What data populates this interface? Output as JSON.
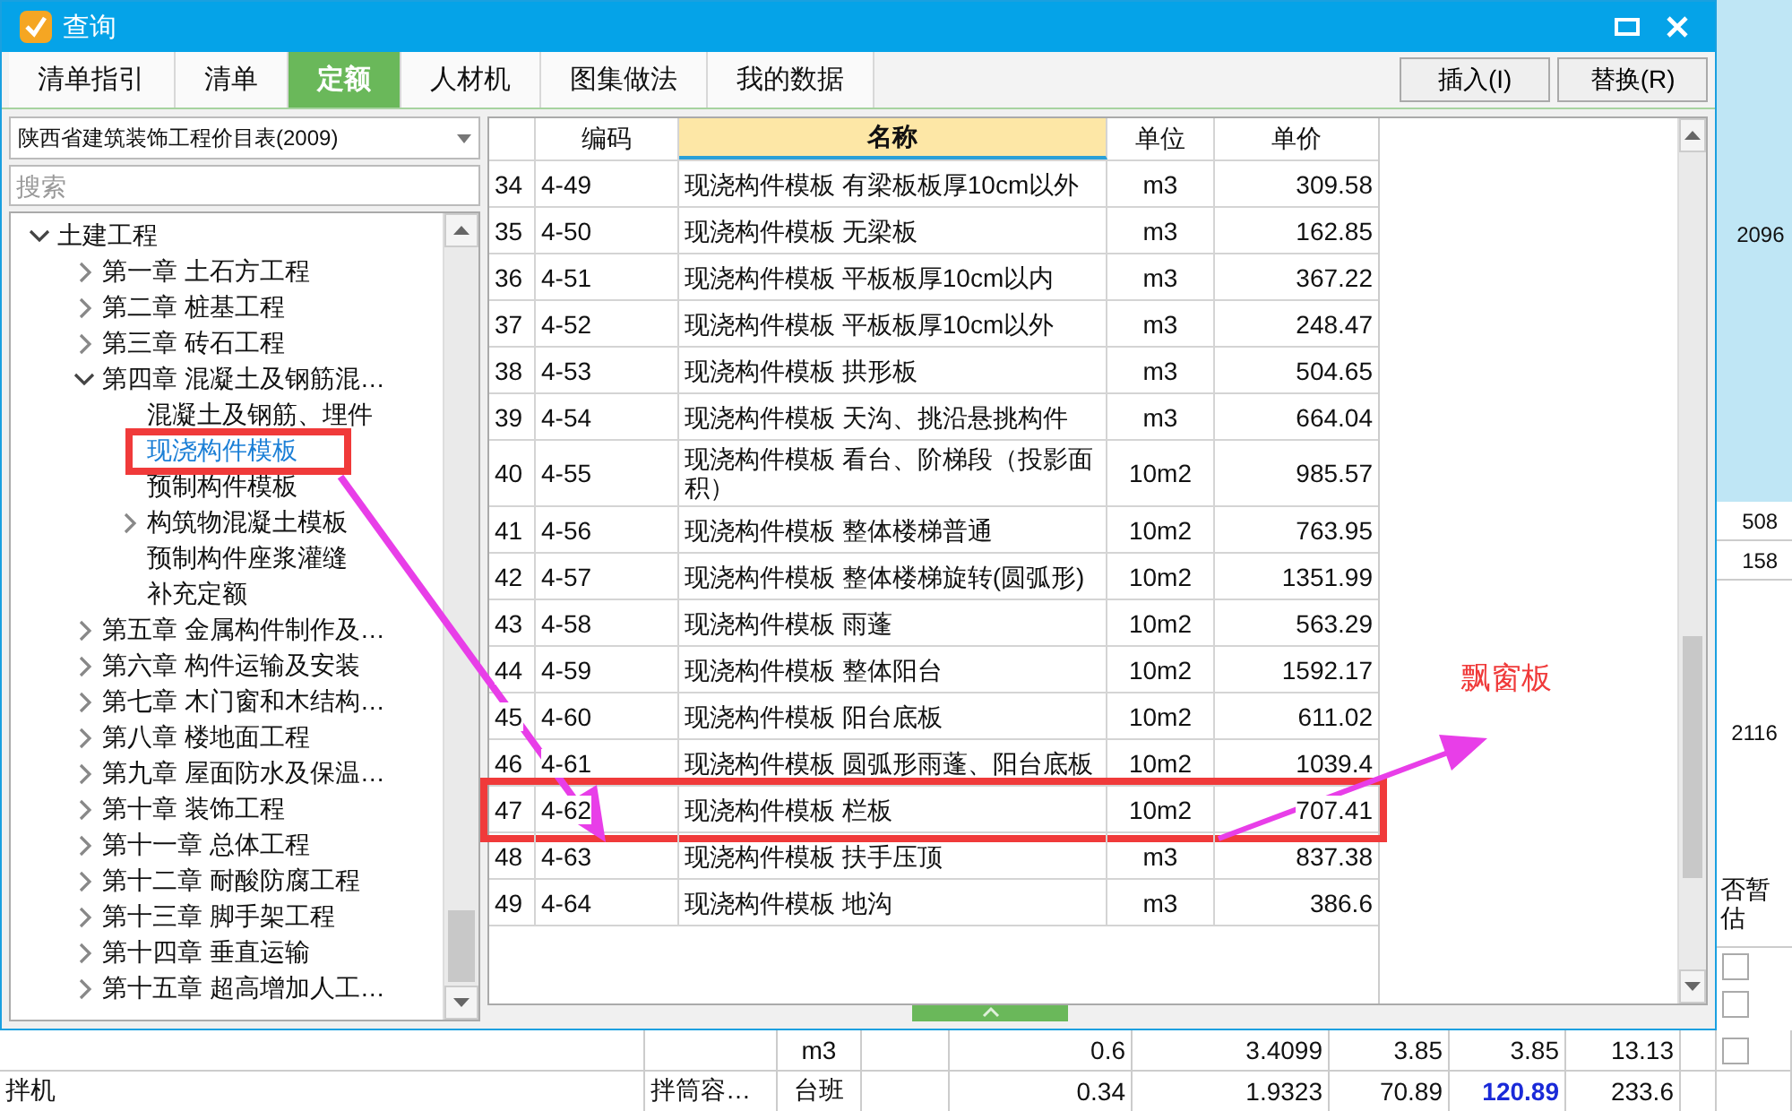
{
  "window": {
    "title": "查询"
  },
  "tabs": [
    {
      "label": "清单指引",
      "selected": false
    },
    {
      "label": "清单",
      "selected": false
    },
    {
      "label": "定额",
      "selected": true
    },
    {
      "label": "人材机",
      "selected": false
    },
    {
      "label": "图集做法",
      "selected": false
    },
    {
      "label": "我的数据",
      "selected": false
    }
  ],
  "buttons": [
    "插入(I)",
    "替换(R)"
  ],
  "library": {
    "value": "陕西省建筑装饰工程价目表(2009)"
  },
  "search": {
    "placeholder": "搜索"
  },
  "tree": {
    "items": [
      {
        "label": "土建工程",
        "expanded": true,
        "selected": false,
        "children": [
          {
            "label": "第一章  土石方工程",
            "expanded": false,
            "selected": false
          },
          {
            "label": "第二章  桩基工程",
            "expanded": false,
            "selected": false
          },
          {
            "label": "第三章  砖石工程",
            "expanded": false,
            "selected": false
          },
          {
            "label": "第四章  混凝土及钢筋混…",
            "expanded": true,
            "selected": false,
            "children": [
              {
                "label": "混凝土及钢筋、埋件",
                "selected": false
              },
              {
                "label": "现浇构件模板",
                "selected": true,
                "marked": true
              },
              {
                "label": "预制构件模板",
                "selected": false
              },
              {
                "label": "构筑物混凝土模板",
                "expanded": false,
                "selected": false
              },
              {
                "label": "预制构件座浆灌缝",
                "selected": false
              },
              {
                "label": "补充定额",
                "selected": false
              }
            ]
          },
          {
            "label": "第五章  金属构件制作及…",
            "expanded": false,
            "selected": false
          },
          {
            "label": "第六章  构件运输及安装",
            "expanded": false,
            "selected": false
          },
          {
            "label": "第七章  木门窗和木结构…",
            "expanded": false,
            "selected": false
          },
          {
            "label": "第八章  楼地面工程",
            "expanded": false,
            "selected": false
          },
          {
            "label": "第九章  屋面防水及保温…",
            "expanded": false,
            "selected": false
          },
          {
            "label": "第十章  装饰工程",
            "expanded": false,
            "selected": false
          },
          {
            "label": "第十一章  总体工程",
            "expanded": false,
            "selected": false
          },
          {
            "label": "第十二章  耐酸防腐工程",
            "expanded": false,
            "selected": false
          },
          {
            "label": "第十三章  脚手架工程",
            "expanded": false,
            "selected": false
          },
          {
            "label": "第十四章  垂直运输",
            "expanded": false,
            "selected": false
          },
          {
            "label": "第十五章  超高增加人工…",
            "expanded": false,
            "selected": false
          }
        ]
      }
    ]
  },
  "table": {
    "columns": [
      {
        "label": "编码",
        "selected": false
      },
      {
        "label": "名称",
        "selected": true
      },
      {
        "label": "单位",
        "selected": false
      },
      {
        "label": "单价",
        "selected": false
      }
    ],
    "rows": [
      {
        "no": "34",
        "code": "4-49",
        "name": "现浇构件模板 有梁板板厚10cm以外",
        "unit": "m3",
        "price": "309.58",
        "marked": false
      },
      {
        "no": "35",
        "code": "4-50",
        "name": "现浇构件模板 无梁板",
        "unit": "m3",
        "price": "162.85",
        "marked": false
      },
      {
        "no": "36",
        "code": "4-51",
        "name": "现浇构件模板 平板板厚10cm以内",
        "unit": "m3",
        "price": "367.22",
        "marked": false
      },
      {
        "no": "37",
        "code": "4-52",
        "name": "现浇构件模板 平板板厚10cm以外",
        "unit": "m3",
        "price": "248.47",
        "marked": false
      },
      {
        "no": "38",
        "code": "4-53",
        "name": "现浇构件模板 拱形板",
        "unit": "m3",
        "price": "504.65",
        "marked": false
      },
      {
        "no": "39",
        "code": "4-54",
        "name": "现浇构件模板 天沟、挑沿悬挑构件",
        "unit": "m3",
        "price": "664.04",
        "marked": false
      },
      {
        "no": "40",
        "code": "4-55",
        "name": "现浇构件模板 看台、阶梯段（投影面积）",
        "unit": "10m2",
        "price": "985.57",
        "marked": false
      },
      {
        "no": "41",
        "code": "4-56",
        "name": "现浇构件模板 整体楼梯普通",
        "unit": "10m2",
        "price": "763.95",
        "marked": false
      },
      {
        "no": "42",
        "code": "4-57",
        "name": "现浇构件模板 整体楼梯旋转(圆弧形)",
        "unit": "10m2",
        "price": "1351.99",
        "marked": false
      },
      {
        "no": "43",
        "code": "4-58",
        "name": "现浇构件模板 雨蓬",
        "unit": "10m2",
        "price": "563.29",
        "marked": false
      },
      {
        "no": "44",
        "code": "4-59",
        "name": "现浇构件模板 整体阳台",
        "unit": "10m2",
        "price": "1592.17",
        "marked": false
      },
      {
        "no": "45",
        "code": "4-60",
        "name": "现浇构件模板 阳台底板",
        "unit": "10m2",
        "price": "611.02",
        "marked": false
      },
      {
        "no": "46",
        "code": "4-61",
        "name": "现浇构件模板 圆弧形雨蓬、阳台底板",
        "unit": "10m2",
        "price": "1039.4",
        "marked": false
      },
      {
        "no": "47",
        "code": "4-62",
        "name": "现浇构件模板 栏板",
        "unit": "10m2",
        "price": "707.41",
        "marked": true
      },
      {
        "no": "48",
        "code": "4-63",
        "name": "现浇构件模板 扶手压顶",
        "unit": "m3",
        "price": "837.38",
        "marked": false
      },
      {
        "no": "49",
        "code": "4-64",
        "name": "现浇构件模板 地沟",
        "unit": "m3",
        "price": "386.6",
        "marked": false
      }
    ]
  },
  "annotation": {
    "note": "飘窗板"
  },
  "right_strip": {
    "values": [
      "2096",
      "508",
      "158",
      "2116"
    ],
    "header": "否暂估",
    "checkboxes": [
      {
        "checked": false
      },
      {
        "checked": false
      }
    ]
  },
  "sheet": {
    "rows": [
      {
        "column_3": "m3",
        "column_5": "0.6",
        "column_6": "3.4099",
        "column_7": "3.85",
        "column_8": "3.85",
        "column_9": "13.13",
        "checked": false
      },
      {
        "column_1": "拌机",
        "column_2": "拌筒容…",
        "column_3": "台班",
        "column_5": "0.34",
        "column_6": "1.9323",
        "column_7": "70.89",
        "column_8": {
          "text": "120.89",
          "emphasized": true
        },
        "column_9": "233.6"
      }
    ]
  }
}
